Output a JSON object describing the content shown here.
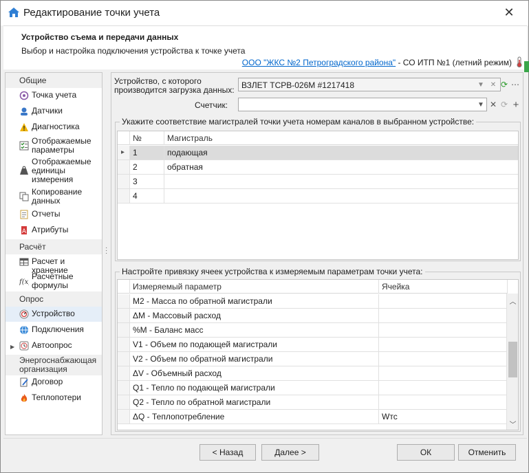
{
  "window": {
    "title": "Редактирование точки учета"
  },
  "header": {
    "title": "Устройство съема и передачи данных",
    "subtitle": "Выбор и настройка подключения устройства к точке учета",
    "link": "ООО \"ЖКС №2 Петроградского района\"",
    "link_suffix": " - СО ИТП №1 (летний режим)"
  },
  "sidebar": {
    "groups": {
      "general": "Общие",
      "calc": "Расчёт",
      "poll": "Опрос",
      "supplier": "Энергоснабжающая организация"
    },
    "items": {
      "point": "Точка учета",
      "sensors": "Датчики",
      "diagnostics": "Диагностика",
      "params": "Отображаемые параметры",
      "units": "Отображаемые единицы измерения",
      "copy": "Копирование данных",
      "reports": "Отчеты",
      "attrs": "Атрибуты",
      "calc_store": "Расчет и хранение",
      "formulas": "Расчётные формулы",
      "device": "Устройство",
      "connections": "Подключения",
      "autopoll": "Автоопрос",
      "contract": "Договор",
      "heatloss": "Теплопотери"
    }
  },
  "main": {
    "device_label_1": "Устройство, с которого",
    "device_label_2": "производится загрузка данных:",
    "device_value": "ВЗЛЕТ ТСРВ-026М #1217418",
    "counter_label": "Счетчик:",
    "counter_value": "",
    "channels_legend": "Укажите соответствие магистралей точки учета номерам каналов в выбранном устройстве:",
    "channels_cols": {
      "num": "№",
      "line": "Магистраль"
    },
    "channels_rows": [
      {
        "num": "1",
        "line": "подающая"
      },
      {
        "num": "2",
        "line": "обратная"
      },
      {
        "num": "3",
        "line": ""
      },
      {
        "num": "4",
        "line": ""
      }
    ],
    "cells_legend": "Настройте привязку ячеек устройства к измеряемым параметрам точки учета:",
    "cells_cols": {
      "param": "Измеряемый параметр",
      "cell": "Ячейка"
    },
    "cells_rows": [
      {
        "param": "M2 - Масса по обратной магистрали",
        "cell": ""
      },
      {
        "param": "ΔM - Массовый расход",
        "cell": ""
      },
      {
        "param": "%M - Баланс масс",
        "cell": ""
      },
      {
        "param": "V1 - Объем по подающей магистрали",
        "cell": ""
      },
      {
        "param": "V2 - Объем по обратной магистрали",
        "cell": ""
      },
      {
        "param": "ΔV - Объемный расход",
        "cell": ""
      },
      {
        "param": "Q1 - Тепло по подающей магистрали",
        "cell": ""
      },
      {
        "param": "Q2 - Тепло по обратной магистрали",
        "cell": ""
      },
      {
        "param": "ΔQ - Теплопотребление",
        "cell": "Wтс"
      }
    ]
  },
  "footer": {
    "back": "< Назад",
    "next": "Далее >",
    "ok": "ОК",
    "cancel": "Отменить"
  },
  "colors": {
    "link": "#0066cc",
    "accent_green": "#3aa64a",
    "selected_row": "#dcdcdc"
  }
}
